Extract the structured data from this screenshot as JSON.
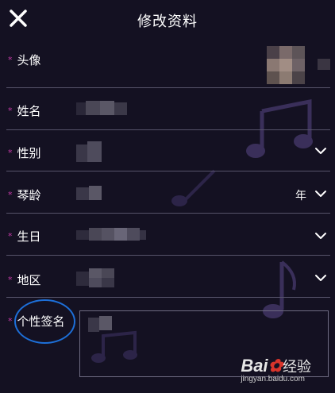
{
  "header": {
    "title": "修改资料",
    "close_icon": "close-icon"
  },
  "fields": {
    "avatar": {
      "label": "头像"
    },
    "name": {
      "label": "姓名"
    },
    "gender": {
      "label": "性别"
    },
    "piano_age": {
      "label": "琴龄",
      "unit": "年"
    },
    "birthday": {
      "label": "生日"
    },
    "region": {
      "label": "地区"
    },
    "signature": {
      "label": "个性签名"
    }
  },
  "required_mark": "*",
  "watermark": {
    "brand_a": "Bai",
    "brand_b": "经验",
    "url": "jingyan.baidu.com"
  },
  "colors": {
    "background": "#141122",
    "accent_star": "#c23aa6",
    "divider": "#56536a",
    "annotation_circle": "#1d6fd8"
  }
}
